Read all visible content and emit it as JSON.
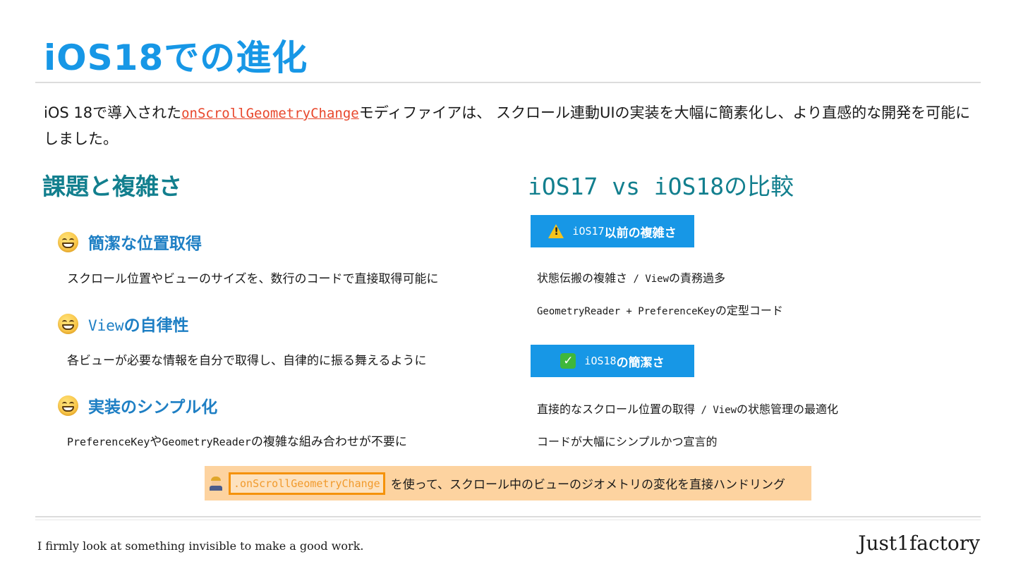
{
  "title": "iOS18での進化",
  "intro": {
    "before": "iOS 18で導入された",
    "code": "onScrollGeometryChange",
    "after": "モディファイアは、 スクロール連動UIの実装を大幅に簡素化し、より直感的な開発を可能にしました。"
  },
  "left": {
    "heading": "課題と複雑さ",
    "features": [
      {
        "title": "簡潔な位置取得",
        "desc": "スクロール位置やビューのサイズを、数行のコードで直接取得可能に"
      },
      {
        "title_mono": "View",
        "title_rest": "の自律性",
        "desc": "各ビューが必要な情報を自分で取得し、自律的に振る舞えるように"
      },
      {
        "title": "実装のシンプル化",
        "desc_mono1": "PreferenceKey",
        "desc_mid": "や",
        "desc_mono2": "GeometryReader",
        "desc_rest": "の複雑な組み合わせが不要に"
      }
    ]
  },
  "right": {
    "heading": "iOS17 vs iOS18の比較",
    "badge1": {
      "mono": "iOS17",
      "rest": "以前の複雑さ"
    },
    "lines1": [
      {
        "a": "状態伝搬の複雑さ",
        "sep": " / ",
        "mono": "View",
        "b": "の責務過多"
      },
      {
        "mono": "GeometryReader + PreferenceKey",
        "b": "の定型コード"
      }
    ],
    "badge2": {
      "mono": "iOS18",
      "rest": "の簡潔さ"
    },
    "lines2": [
      {
        "a": "直接的なスクロール位置の取得",
        "sep": " / ",
        "mono": "View",
        "b": "の状態管理の最適化"
      },
      {
        "a": "コードが大幅にシンプルかつ宣言的"
      }
    ]
  },
  "note": {
    "code": ".onScrollGeometryChange",
    "text": "を使って、スクロール中のビューのジオメトリの変化を直接ハンドリング"
  },
  "footer": {
    "tagline": "I firmly look at something invisible to make a good work.",
    "brand": "Just1factory"
  },
  "colors": {
    "title": "#1797e6",
    "section_heading": "#127f8e",
    "feature_title": "#1e7fc4",
    "badge": "#1797e6",
    "note_bg": "#fdd3a0",
    "note_border": "#f5920a",
    "link": "#e8472c"
  },
  "icons": {
    "features": "grinning-face-icon",
    "badge1": "warning-icon",
    "badge2": "check-mark-icon",
    "note": "construction-worker-icon"
  }
}
